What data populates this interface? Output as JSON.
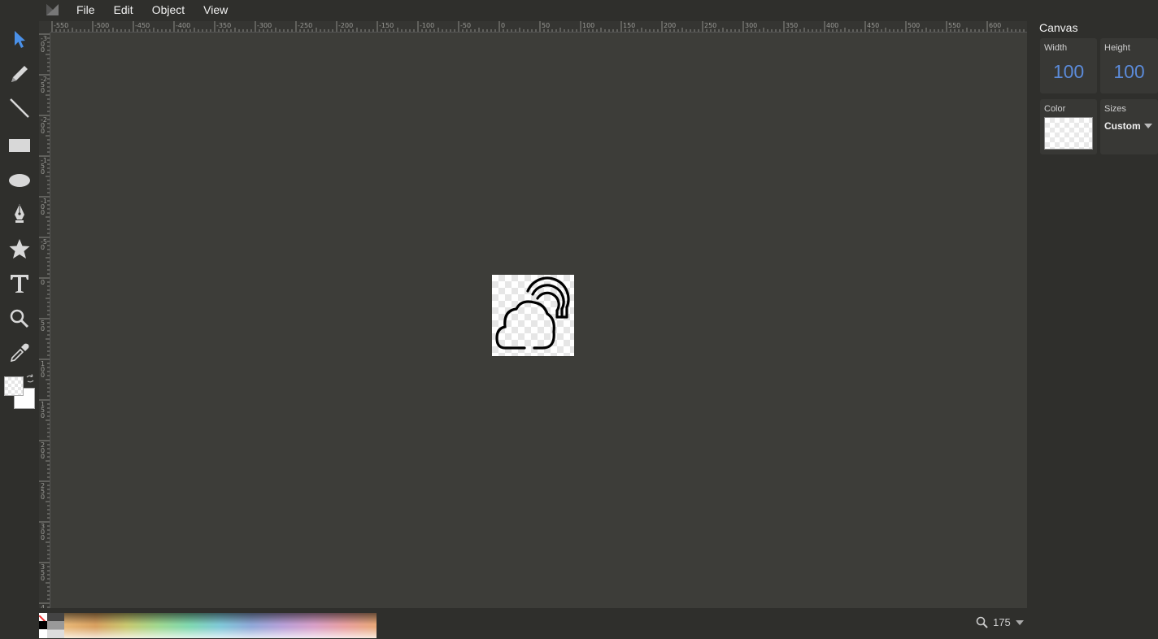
{
  "menubar": {
    "logo_icon": "app-logo-icon",
    "items": [
      "File",
      "Edit",
      "Object",
      "View"
    ]
  },
  "toolbar": {
    "tools": [
      {
        "name": "select-tool",
        "icon": "pointer-arrow-icon",
        "active": true
      },
      {
        "name": "pencil-tool",
        "icon": "pencil-icon"
      },
      {
        "name": "line-tool",
        "icon": "line-icon"
      },
      {
        "name": "rectangle-tool",
        "icon": "rectangle-icon"
      },
      {
        "name": "ellipse-tool",
        "icon": "ellipse-icon"
      },
      {
        "name": "pen-tool",
        "icon": "pen-nib-icon"
      },
      {
        "name": "star-tool",
        "icon": "star-icon"
      },
      {
        "name": "text-tool",
        "icon": "text-t-icon"
      },
      {
        "name": "zoom-tool",
        "icon": "magnifier-icon"
      },
      {
        "name": "eyedropper-tool",
        "icon": "eyedropper-icon"
      }
    ],
    "swap_icon": "swap-colors-icon"
  },
  "ruler": {
    "top_labels": [
      "-550",
      "-500",
      "-450",
      "-400",
      "-350",
      "-300",
      "-250",
      "-200",
      "-150",
      "-100",
      "-50",
      "0",
      "50",
      "100",
      "150",
      "200",
      "250",
      "300",
      "350",
      "400",
      "450",
      "500",
      "550",
      "600",
      "650"
    ],
    "left_labels": [
      "-300",
      "-250",
      "-200",
      "-150",
      "-100",
      "-50",
      "0",
      "50",
      "100",
      "150",
      "200",
      "250",
      "300",
      "350",
      "400"
    ]
  },
  "panel": {
    "title": "Canvas",
    "width_label": "Width",
    "width_value": "100",
    "height_label": "Height",
    "height_value": "100",
    "color_label": "Color",
    "sizes_label": "Sizes",
    "sizes_value": "Custom"
  },
  "zoom": {
    "value": "175",
    "icon": "magnifier-icon"
  },
  "colors": {
    "accent": "#5b8ad8",
    "workarea": "#3d3d39",
    "chrome": "#2f2f2c"
  }
}
